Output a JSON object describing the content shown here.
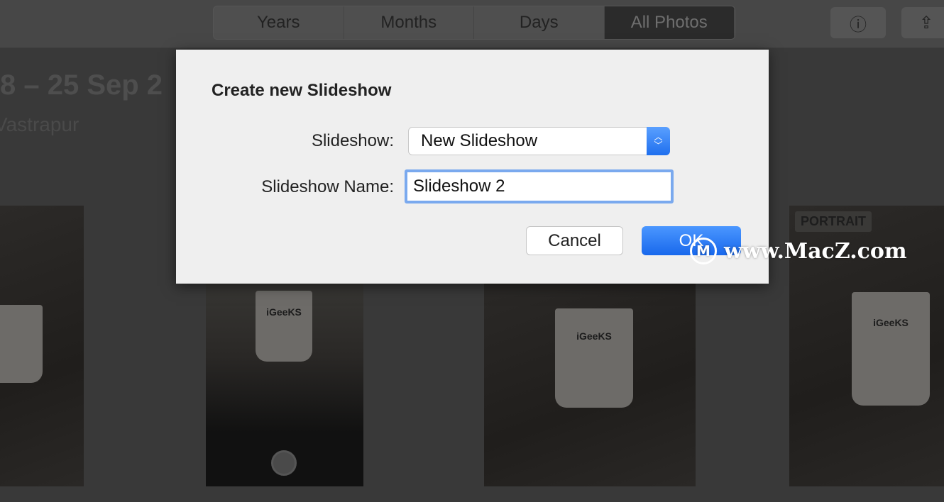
{
  "toolbar": {
    "tabs": [
      {
        "label": "Years"
      },
      {
        "label": "Months"
      },
      {
        "label": "Days"
      },
      {
        "label": "All Photos",
        "active": true
      }
    ],
    "info_icon": "ⓘ",
    "share_icon": "⇪"
  },
  "header": {
    "date_range": "8 – 25 Sep 2",
    "location": "Vastrapur"
  },
  "photos": {
    "badge": "PORTRAIT",
    "mug_text": "iGeeKS"
  },
  "dialog": {
    "title": "Create new Slideshow",
    "slideshow_label": "Slideshow:",
    "slideshow_value": "New Slideshow",
    "name_label": "Slideshow Name:",
    "name_value": "Slideshow 2",
    "cancel_label": "Cancel",
    "ok_label": "OK",
    "accent_color": "#1f6fee"
  },
  "watermark": {
    "text": "www.MacZ.com",
    "logo": "M"
  }
}
